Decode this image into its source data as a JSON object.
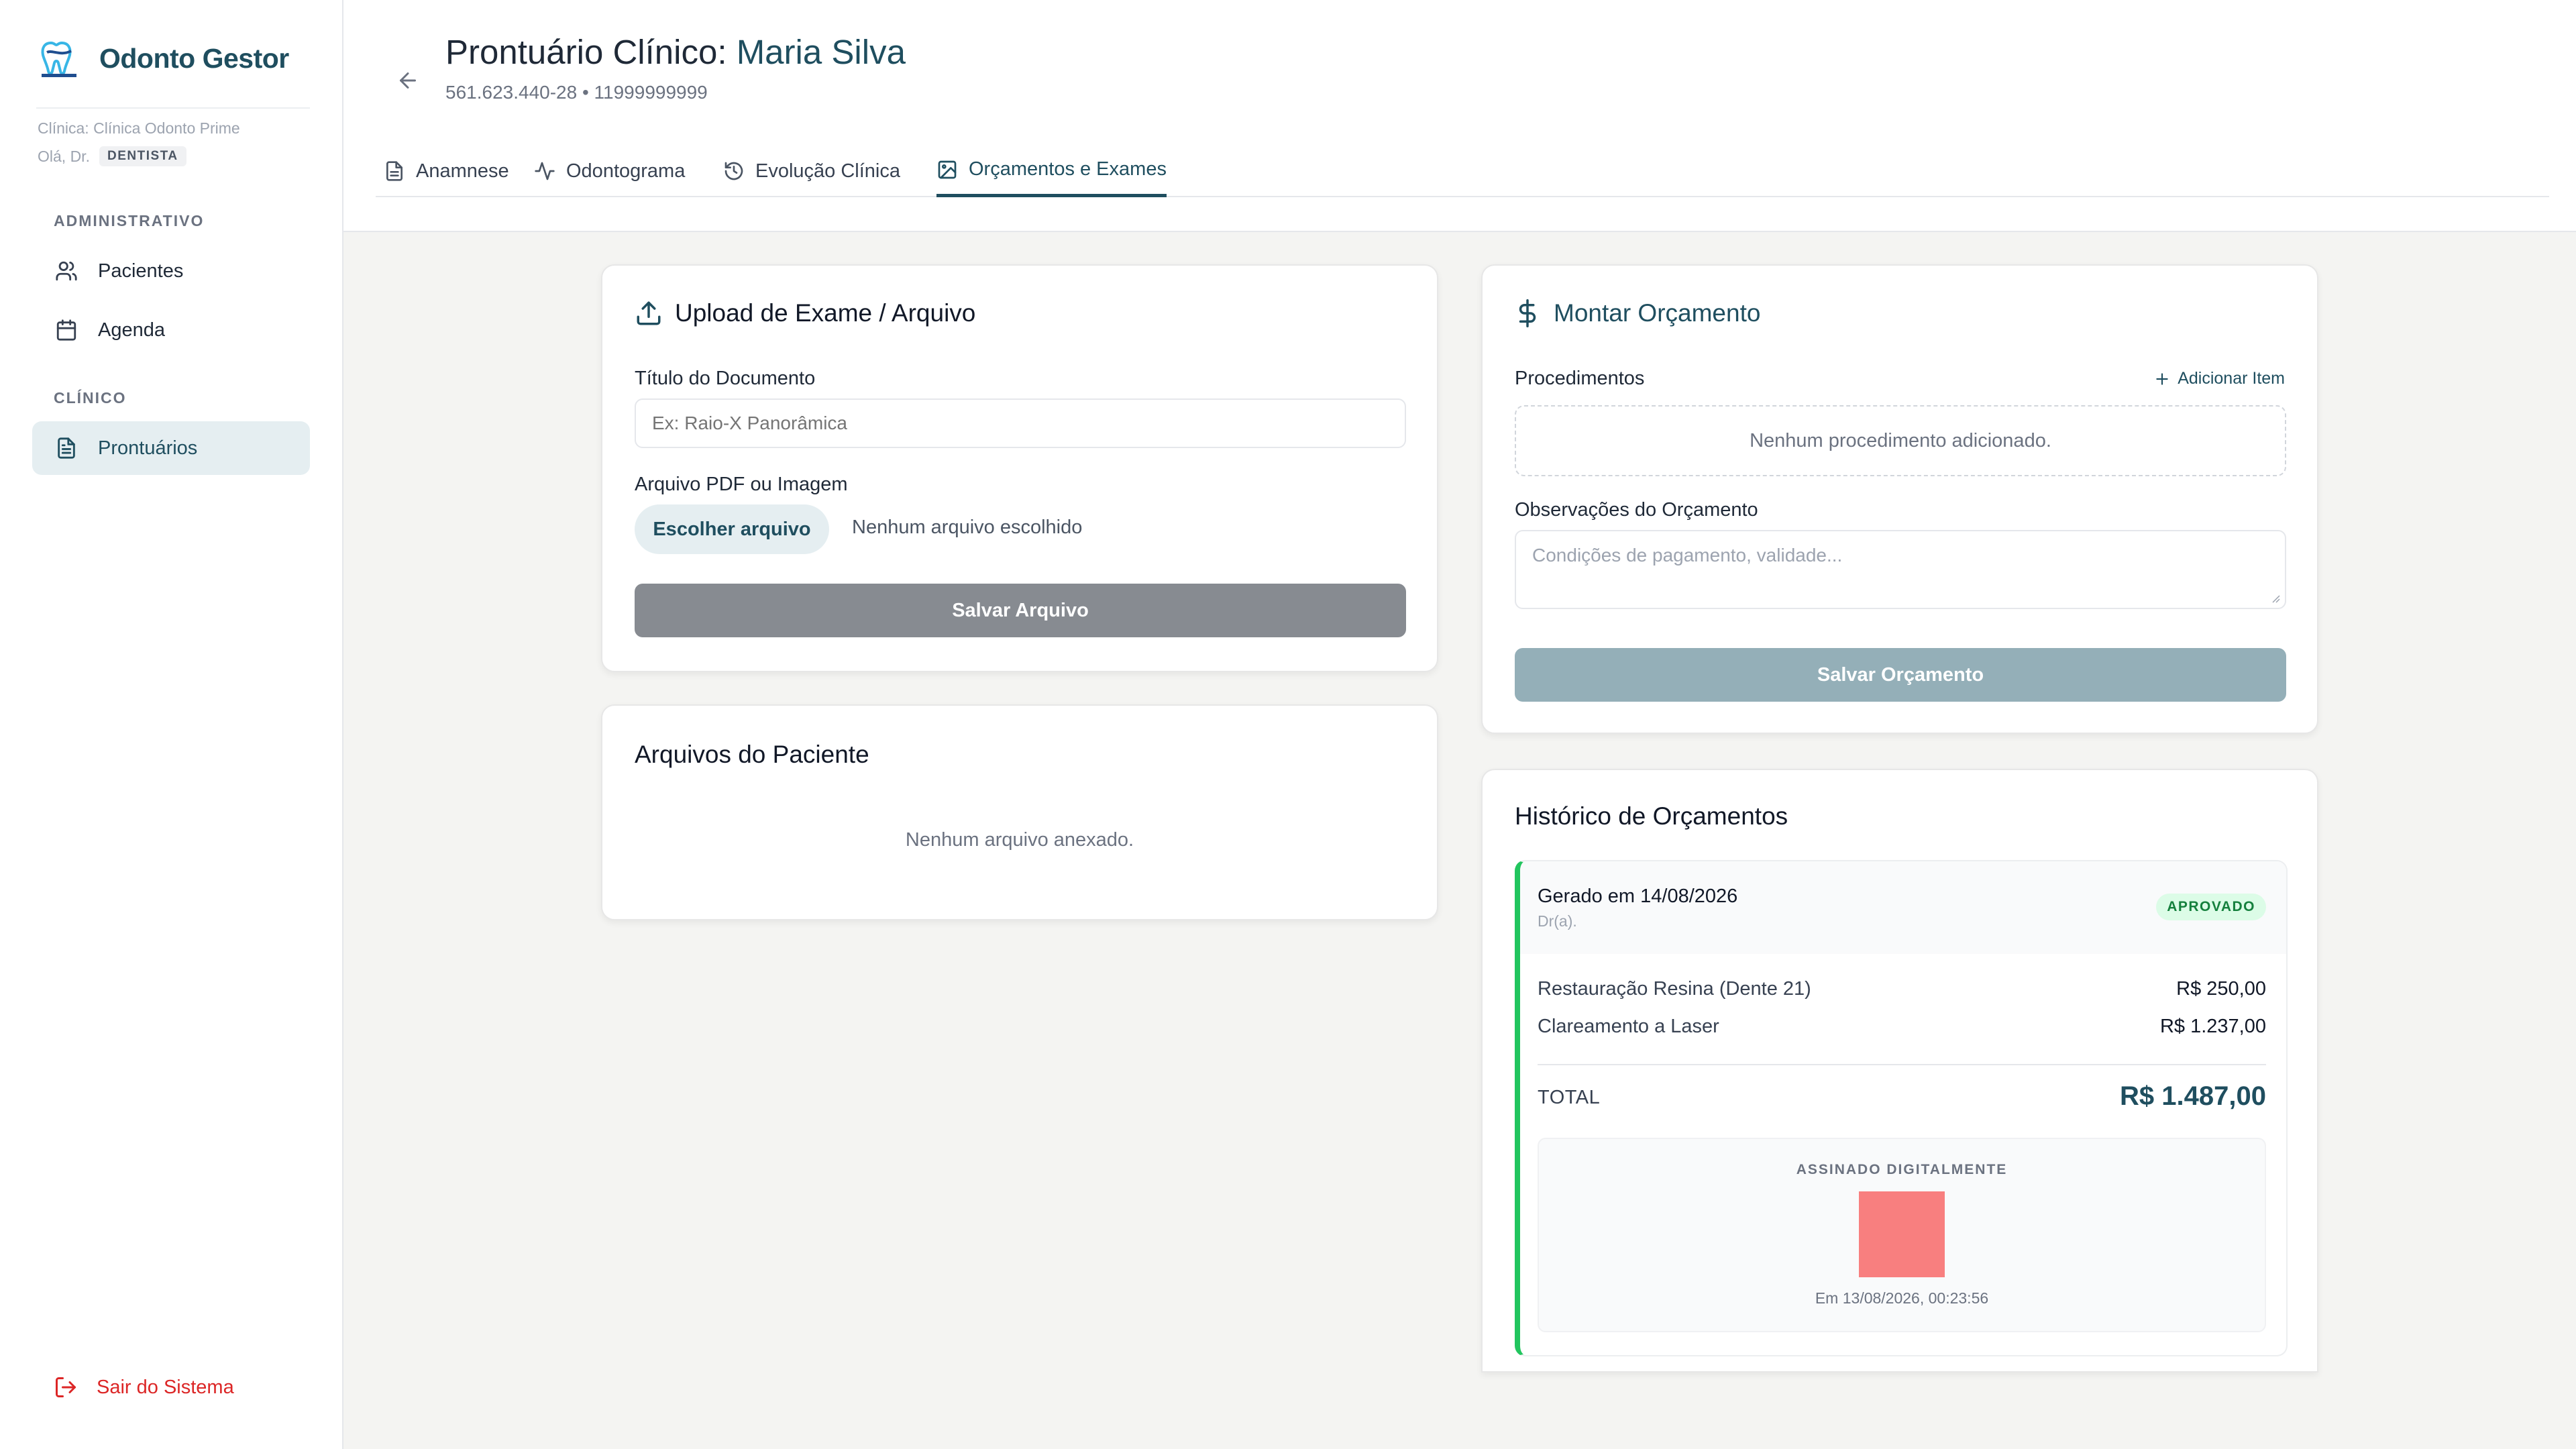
{
  "app": {
    "name": "Odonto Gestor"
  },
  "sidebar": {
    "clinic_prefix": "Clínica:",
    "clinic_name": "Clínica Odonto Prime",
    "greeting": "Olá, Dr.",
    "role": "DENTISTA",
    "sections": [
      {
        "label": "ADMINISTRATIVO",
        "items": [
          {
            "label": "Pacientes",
            "icon": "users-icon"
          },
          {
            "label": "Agenda",
            "icon": "calendar-icon"
          }
        ]
      },
      {
        "label": "CLÍNICO",
        "items": [
          {
            "label": "Prontuários",
            "icon": "file-text-icon",
            "active": true
          }
        ]
      }
    ],
    "logout_label": "Sair do Sistema"
  },
  "header": {
    "title_prefix": "Prontuário Clínico:",
    "patient_name": "Maria Silva",
    "patient_info": "561.623.440-28 • 11999999999",
    "tabs": [
      {
        "label": "Anamnese",
        "icon": "file-icon"
      },
      {
        "label": "Odontograma",
        "icon": "activity-icon"
      },
      {
        "label": "Evolução Clínica",
        "icon": "history-icon"
      },
      {
        "label": "Orçamentos e Exames",
        "icon": "image-icon",
        "active": true
      }
    ]
  },
  "upload": {
    "title": "Upload de Exame / Arquivo",
    "doc_title_label": "Título do Documento",
    "doc_title_placeholder": "Ex: Raio-X Panorâmica",
    "file_label": "Arquivo PDF ou Imagem",
    "choose_button": "Escolher arquivo",
    "file_status": "Nenhum arquivo escolhido",
    "save_button": "Salvar Arquivo"
  },
  "patient_files": {
    "title": "Arquivos do Paciente",
    "empty": "Nenhum arquivo anexado."
  },
  "budget": {
    "title": "Montar Orçamento",
    "procedures_label": "Procedimentos",
    "add_item": "Adicionar Item",
    "procedures_empty": "Nenhum procedimento adicionado.",
    "notes_label": "Observações do Orçamento",
    "notes_placeholder": "Condições de pagamento, validade...",
    "save_button": "Salvar Orçamento"
  },
  "history": {
    "title": "Histórico de Orçamentos",
    "entries": [
      {
        "generated": "Gerado em 14/08/2026",
        "doctor": "Dr(a).",
        "status": "APROVADO",
        "items": [
          {
            "name": "Restauração Resina (Dente 21)",
            "value": "R$ 250,00"
          },
          {
            "name": "Clareamento a Laser",
            "value": "R$ 1.237,00"
          }
        ],
        "total_label": "TOTAL",
        "total_value": "R$ 1.487,00",
        "signature_label": "ASSINADO DIGITALMENTE",
        "signature_time": "Em 13/08/2026, 00:23:56"
      }
    ]
  },
  "colors": {
    "brand": "#1f4e5f",
    "active_bg": "#e5eef1",
    "danger": "#dc2626",
    "approved": "#22c55e",
    "save_file_btn": "#878b91",
    "save_budget_btn": "#94afb8"
  }
}
